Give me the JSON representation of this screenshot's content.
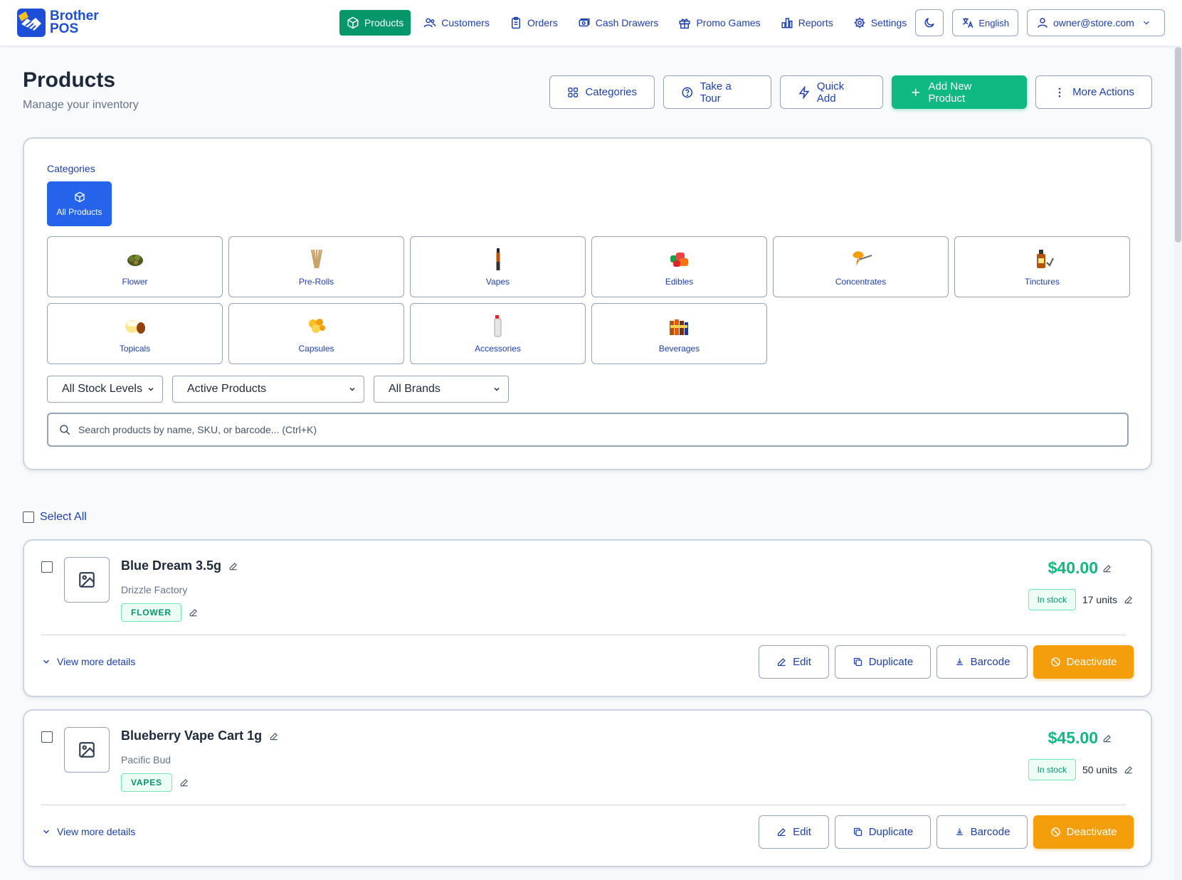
{
  "app": {
    "logo_line1": "Brother",
    "logo_line2": "POS"
  },
  "nav": {
    "items": [
      {
        "label": "Products",
        "icon": "box-icon",
        "active": true
      },
      {
        "label": "Customers",
        "icon": "users-icon"
      },
      {
        "label": "Orders",
        "icon": "clipboard-icon"
      },
      {
        "label": "Cash Drawers",
        "icon": "cash-icon"
      },
      {
        "label": "Promo Games",
        "icon": "gift-icon"
      },
      {
        "label": "Reports",
        "icon": "bar-chart-icon"
      },
      {
        "label": "Settings",
        "icon": "gear-icon"
      }
    ],
    "language": "English",
    "user": "owner@store.com"
  },
  "page": {
    "title": "Products",
    "subtitle": "Manage your inventory",
    "actions": [
      "Categories",
      "Take a Tour",
      "Quick Add",
      "Add New Product",
      "More Actions"
    ]
  },
  "categories": {
    "heading": "Categories",
    "all_label": "All Products",
    "items": [
      "Flower",
      "Pre-Rolls",
      "Vapes",
      "Edibles",
      "Concentrates",
      "Tinctures",
      "Topicals",
      "Capsules",
      "Accessories",
      "Beverages"
    ]
  },
  "filters": {
    "stock": "All Stock Levels",
    "status": "Active Products",
    "brand": "All Brands",
    "search_placeholder": "Search products by name, SKU, or barcode... (Ctrl+K)"
  },
  "select_all": "Select All",
  "products": [
    {
      "name": "Blue Dream 3.5g",
      "brand": "Drizzle Factory",
      "tag": "FLOWER",
      "price": "$40.00",
      "stock_status": "In stock",
      "units": "17 units"
    },
    {
      "name": "Blueberry Vape Cart 1g",
      "brand": "Pacific Bud",
      "tag": "VAPES",
      "price": "$45.00",
      "stock_status": "In stock",
      "units": "50 units"
    }
  ],
  "card_actions": {
    "details": "View more details",
    "edit": "Edit",
    "duplicate": "Duplicate",
    "barcode": "Barcode",
    "deactivate": "Deactivate"
  },
  "colors": {
    "primary_blue": "#1e40af",
    "brand_blue": "#2563eb",
    "green": "#10b981",
    "green_dark": "#059669",
    "orange": "#f59e0b"
  }
}
